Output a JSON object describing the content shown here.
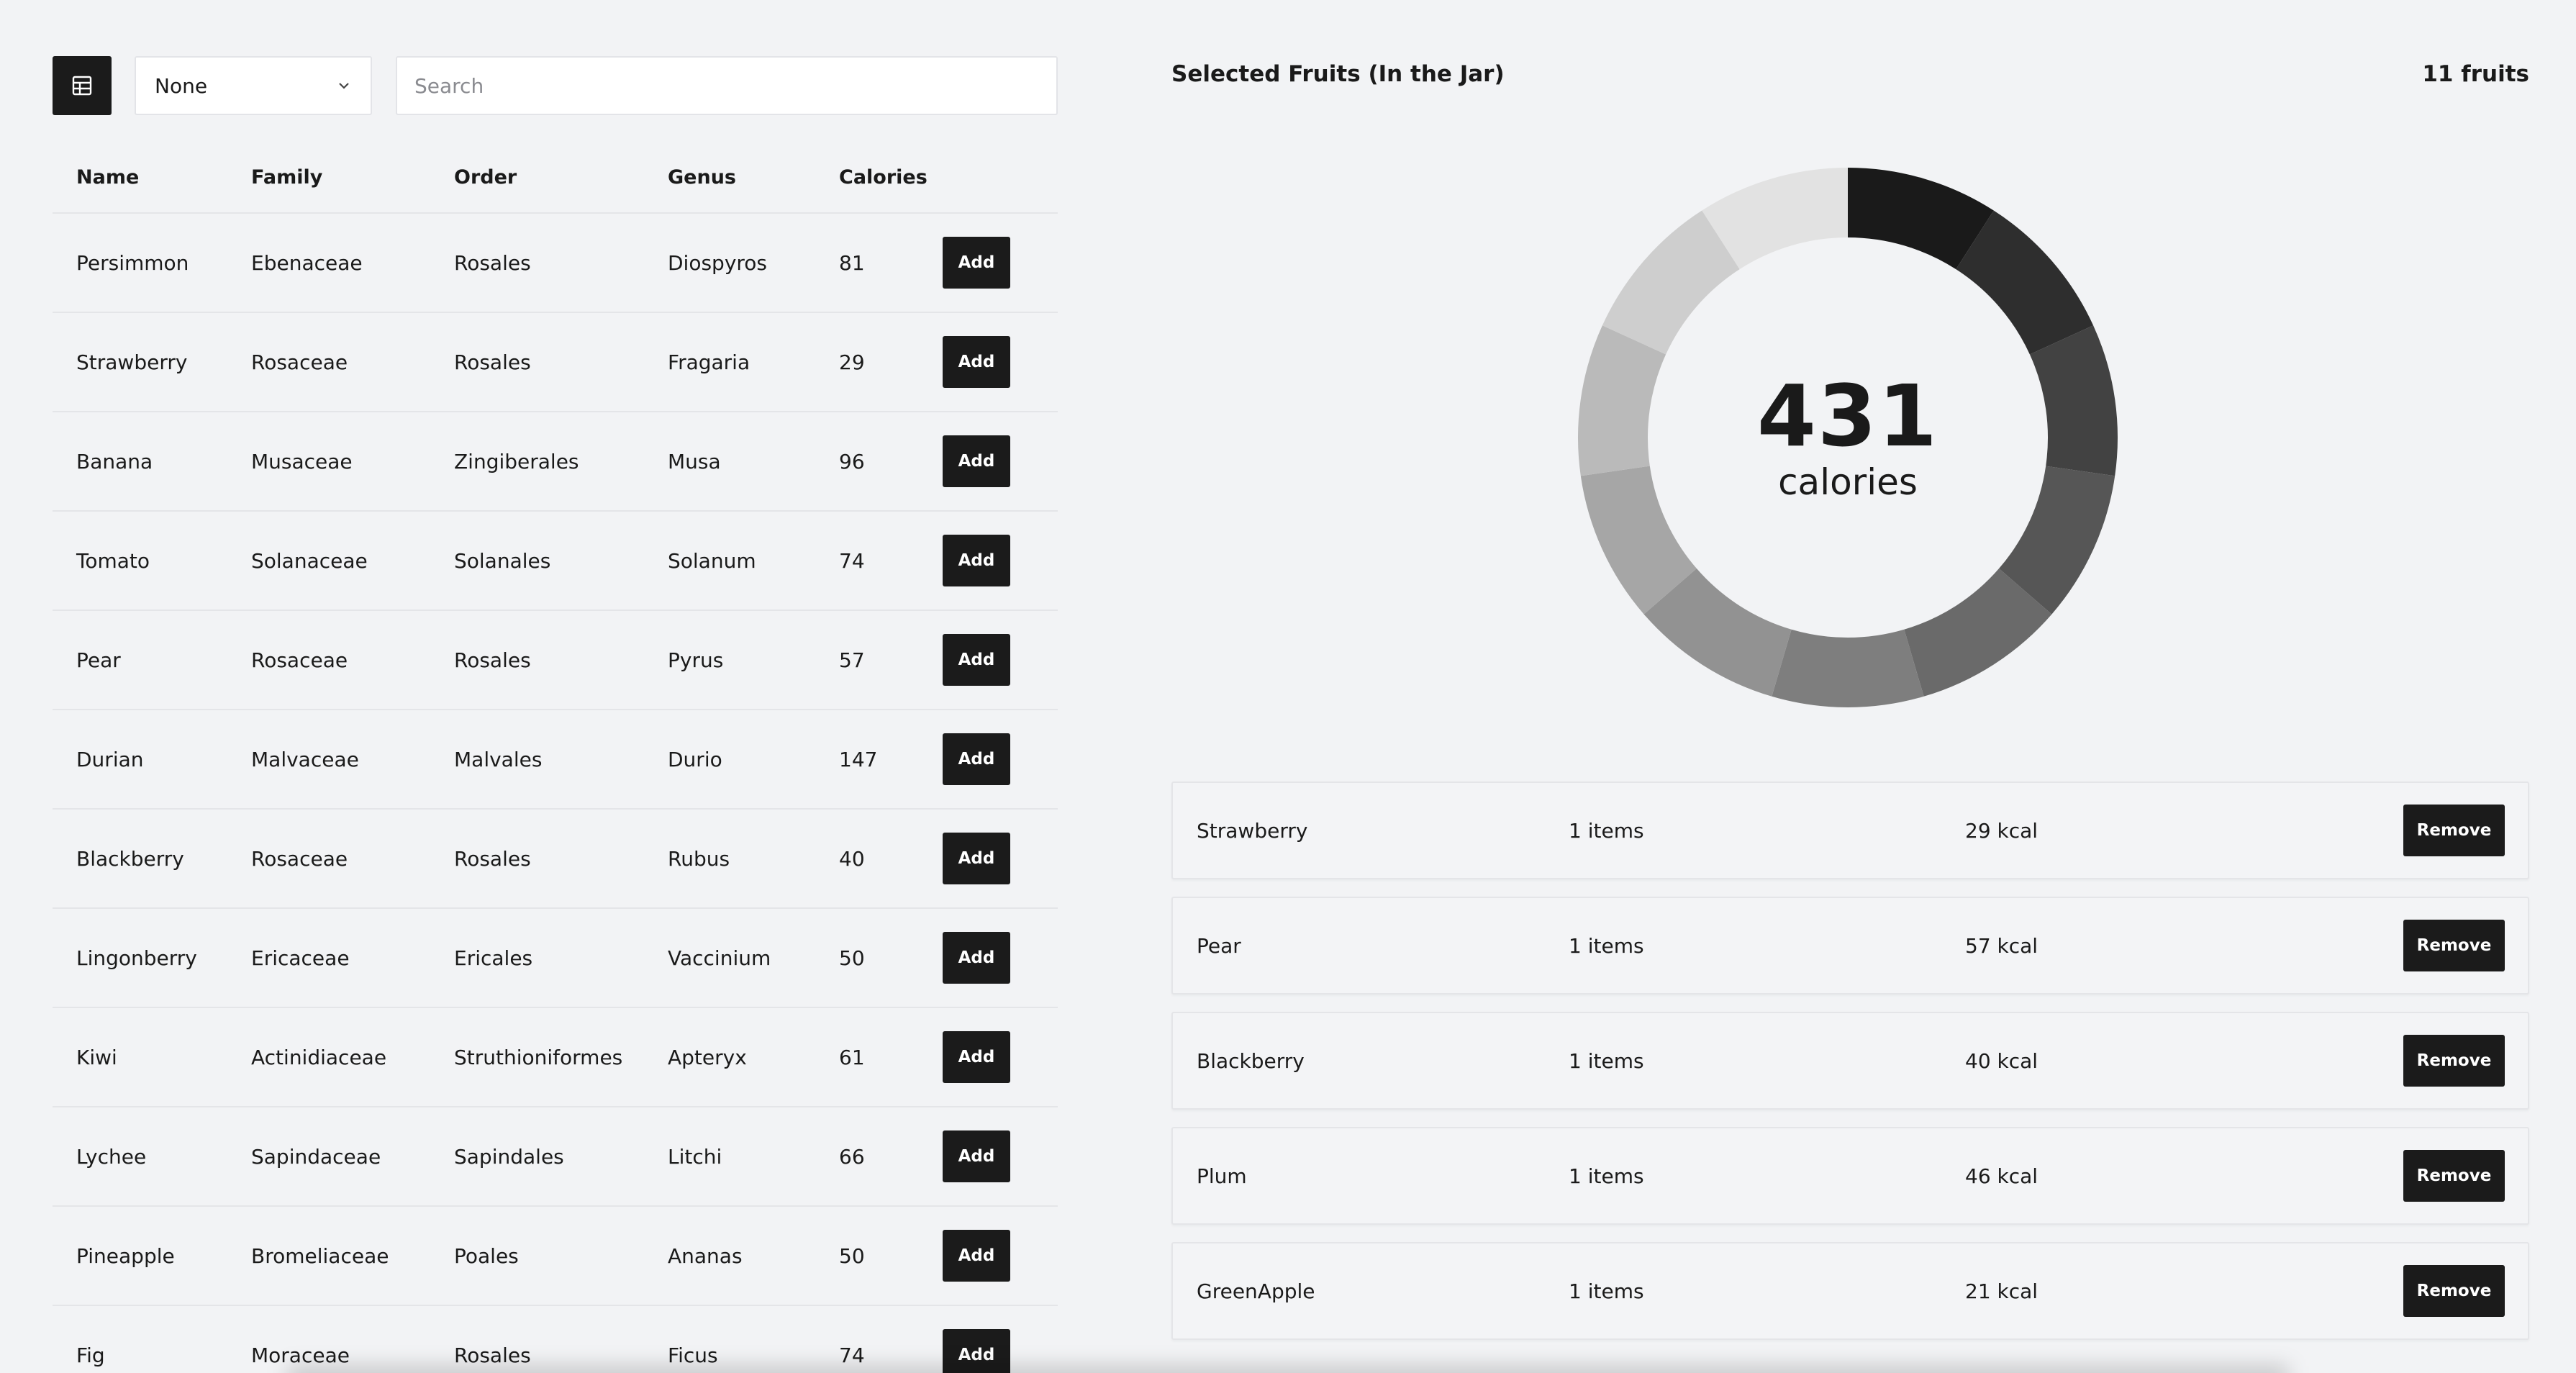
{
  "toolbar": {
    "view_icon": "table-grid-icon",
    "group_by_value": "None",
    "group_by_icon": "chevron-down-icon",
    "search_placeholder": "Search",
    "search_value": ""
  },
  "table": {
    "headers": [
      "Name",
      "Family",
      "Order",
      "Genus",
      "Calories"
    ],
    "add_label": "Add",
    "rows": [
      {
        "name": "Persimmon",
        "family": "Ebenaceae",
        "order": "Rosales",
        "genus": "Diospyros",
        "calories": "81"
      },
      {
        "name": "Strawberry",
        "family": "Rosaceae",
        "order": "Rosales",
        "genus": "Fragaria",
        "calories": "29"
      },
      {
        "name": "Banana",
        "family": "Musaceae",
        "order": "Zingiberales",
        "genus": "Musa",
        "calories": "96"
      },
      {
        "name": "Tomato",
        "family": "Solanaceae",
        "order": "Solanales",
        "genus": "Solanum",
        "calories": "74"
      },
      {
        "name": "Pear",
        "family": "Rosaceae",
        "order": "Rosales",
        "genus": "Pyrus",
        "calories": "57"
      },
      {
        "name": "Durian",
        "family": "Malvaceae",
        "order": "Malvales",
        "genus": "Durio",
        "calories": "147"
      },
      {
        "name": "Blackberry",
        "family": "Rosaceae",
        "order": "Rosales",
        "genus": "Rubus",
        "calories": "40"
      },
      {
        "name": "Lingonberry",
        "family": "Ericaceae",
        "order": "Ericales",
        "genus": "Vaccinium",
        "calories": "50"
      },
      {
        "name": "Kiwi",
        "family": "Actinidiaceae",
        "order": "Struthioniformes",
        "genus": "Apteryx",
        "calories": "61"
      },
      {
        "name": "Lychee",
        "family": "Sapindaceae",
        "order": "Sapindales",
        "genus": "Litchi",
        "calories": "66"
      },
      {
        "name": "Pineapple",
        "family": "Bromeliaceae",
        "order": "Poales",
        "genus": "Ananas",
        "calories": "50"
      },
      {
        "name": "Fig",
        "family": "Moraceae",
        "order": "Rosales",
        "genus": "Ficus",
        "calories": "74"
      }
    ]
  },
  "jar": {
    "title": "Selected Fruits (In the Jar)",
    "count_label": "11 fruits",
    "total": "431",
    "unit": "calories",
    "remove_label": "Remove",
    "items": [
      {
        "name": "Strawberry",
        "qty": "1 items",
        "kcal": "29 kcal"
      },
      {
        "name": "Pear",
        "qty": "1 items",
        "kcal": "57 kcal"
      },
      {
        "name": "Blackberry",
        "qty": "1 items",
        "kcal": "40 kcal"
      },
      {
        "name": "Plum",
        "qty": "1 items",
        "kcal": "46 kcal"
      },
      {
        "name": "GreenApple",
        "qty": "1 items",
        "kcal": "21 kcal"
      }
    ]
  },
  "chart_data": {
    "type": "pie",
    "variant": "donut",
    "slice_count": 11,
    "values": [
      1,
      1,
      1,
      1,
      1,
      1,
      1,
      1,
      1,
      1,
      1
    ],
    "colors": [
      "#1a1a1a",
      "#2e2e2e",
      "#424242",
      "#565656",
      "#6a6a6a",
      "#7e7e7e",
      "#929292",
      "#a6a6a6",
      "#bababa",
      "#cecece",
      "#e2e2e2"
    ],
    "center_value": "431",
    "center_label": "calories"
  }
}
